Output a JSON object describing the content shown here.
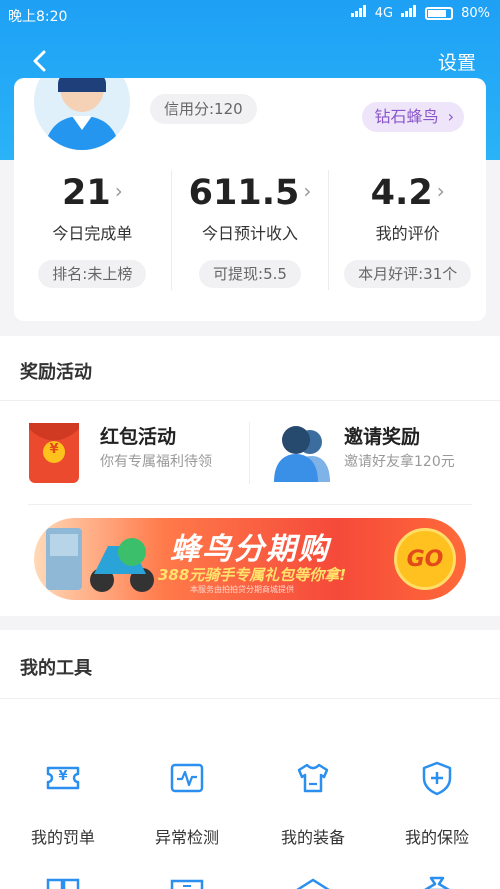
{
  "status_bar": {
    "time": "晚上8:20",
    "network": "4G",
    "battery": "80%"
  },
  "nav": {
    "settings_label": "设置"
  },
  "profile": {
    "credit": "信用分:120",
    "level": "钻石蜂鸟",
    "level_chevron": "›"
  },
  "stats": [
    {
      "value": "21",
      "label": "今日完成单",
      "pill": "排名:未上榜"
    },
    {
      "value": "611.5",
      "label": "今日预计收入",
      "pill": "可提现:5.5"
    },
    {
      "value": "4.2",
      "label": "我的评价",
      "pill": "本月好评:31个"
    }
  ],
  "stat_chevron": "›",
  "rewards": {
    "title": "奖励活动",
    "items": [
      {
        "name": "红包活动",
        "desc": "你有专属福利待领",
        "icon": "red-envelope-icon"
      },
      {
        "name": "邀请奖励",
        "desc": "邀请好友拿120元",
        "icon": "users-icon"
      }
    ],
    "banner": {
      "title": "蜂鸟分期购",
      "subtitle": "388元骑手专属礼包等你拿!",
      "note": "本服务由拍拍贷分期商城提供",
      "go": "GO"
    },
    "envelope_symbol": "¥"
  },
  "tools": {
    "title": "我的工具",
    "items": [
      {
        "label": "我的罚单",
        "icon": "ticket-icon"
      },
      {
        "label": "异常检测",
        "icon": "pulse-icon"
      },
      {
        "label": "我的装备",
        "icon": "shirt-icon"
      },
      {
        "label": "我的保险",
        "icon": "shield-icon"
      }
    ],
    "ticket_symbol": "¥"
  },
  "colors": {
    "header_blue": "#1ea0f5",
    "icon_blue": "#2b8ff0",
    "level_purple": "#8a56c8",
    "envelope_red": "#ec4a2f"
  }
}
